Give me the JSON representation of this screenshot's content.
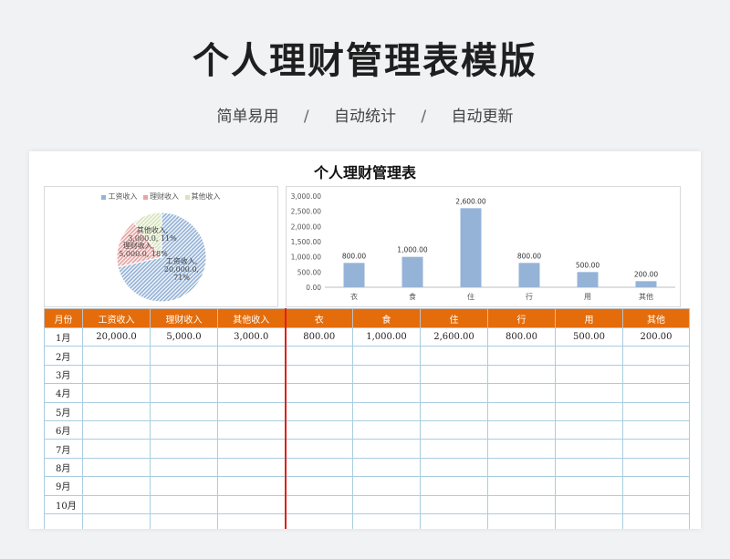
{
  "page": {
    "title": "个人理财管理表模版",
    "subtitle": [
      "简单易用",
      "自动统计",
      "自动更新"
    ],
    "separator": "/"
  },
  "sheet": {
    "title": "个人理财管理表"
  },
  "pie_chart": {
    "type": "pie",
    "legend": [
      "工资收入",
      "理财收入",
      "其他收入"
    ],
    "colors": [
      "#95b3d7",
      "#e6a5a4",
      "#d7e4bd"
    ],
    "slices": [
      {
        "name": "工资收入",
        "value": 20000,
        "label_line1": "工资收入,",
        "label_line2": "20,000.0,",
        "label_line3": "71%"
      },
      {
        "name": "理财收入",
        "value": 5000,
        "label_line1": "理财收入,",
        "label_line2": "5,000.0, 18%"
      },
      {
        "name": "其他收入",
        "value": 3000,
        "label_line1": "其他收入,",
        "label_line2": "3,000.0, 11%"
      }
    ]
  },
  "chart_data": {
    "type": "bar",
    "categories": [
      "衣",
      "食",
      "住",
      "行",
      "用",
      "其他"
    ],
    "values": [
      800,
      1000,
      2600,
      800,
      500,
      200
    ],
    "data_labels": [
      "800.00",
      "1,000.00",
      "2,600.00",
      "800.00",
      "500.00",
      "200.00"
    ],
    "yticks": [
      0,
      500,
      1000,
      1500,
      2000,
      2500,
      3000
    ],
    "ytick_labels": [
      "0.00",
      "500.00",
      "1,000.00",
      "1,500.00",
      "2,000.00",
      "2,500.00",
      "3,000.00"
    ],
    "ylim": [
      0,
      3000
    ],
    "color": "#95b3d7"
  },
  "table": {
    "headers": [
      "月份",
      "工资收入",
      "理财收入",
      "其他收入",
      "衣",
      "食",
      "住",
      "行",
      "用",
      "其他"
    ],
    "rows": [
      [
        "1月",
        "20,000.0",
        "5,000.0",
        "3,000.0",
        "800.00",
        "1,000.00",
        "2,600.00",
        "800.00",
        "500.00",
        "200.00"
      ],
      [
        "2月",
        "",
        "",
        "",
        "",
        "",
        "",
        "",
        "",
        ""
      ],
      [
        "3月",
        "",
        "",
        "",
        "",
        "",
        "",
        "",
        "",
        ""
      ],
      [
        "4月",
        "",
        "",
        "",
        "",
        "",
        "",
        "",
        "",
        ""
      ],
      [
        "5月",
        "",
        "",
        "",
        "",
        "",
        "",
        "",
        "",
        ""
      ],
      [
        "6月",
        "",
        "",
        "",
        "",
        "",
        "",
        "",
        "",
        ""
      ],
      [
        "7月",
        "",
        "",
        "",
        "",
        "",
        "",
        "",
        "",
        ""
      ],
      [
        "8月",
        "",
        "",
        "",
        "",
        "",
        "",
        "",
        "",
        ""
      ],
      [
        "9月",
        "",
        "",
        "",
        "",
        "",
        "",
        "",
        "",
        ""
      ],
      [
        "10月",
        "",
        "",
        "",
        "",
        "",
        "",
        "",
        "",
        ""
      ],
      [
        "",
        "",
        "",
        "",
        "",
        "",
        "",
        "",
        "",
        ""
      ]
    ]
  }
}
